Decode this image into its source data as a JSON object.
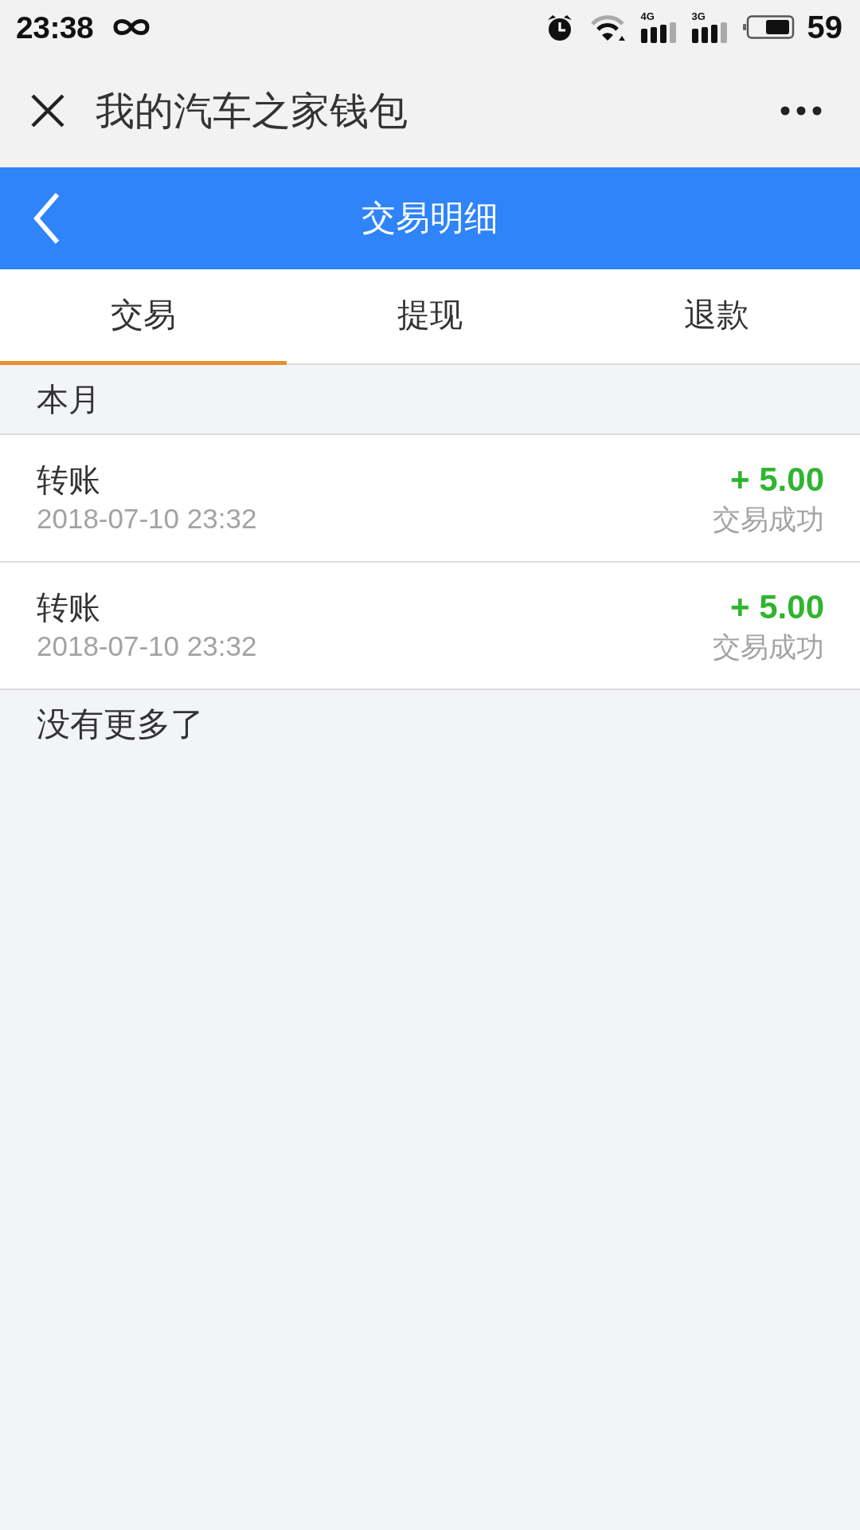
{
  "status_bar": {
    "time": "23:38",
    "networks": [
      {
        "label": "4G"
      },
      {
        "label": "3G"
      }
    ],
    "battery": "59"
  },
  "window": {
    "title": "我的汽车之家钱包"
  },
  "header": {
    "title": "交易明细"
  },
  "tabs": [
    {
      "label": "交易",
      "selected": true
    },
    {
      "label": "提现",
      "selected": false
    },
    {
      "label": "退款",
      "selected": false
    }
  ],
  "sections": [
    {
      "title": "本月",
      "rows": [
        {
          "title": "转账",
          "time": "2018-07-10 23:32",
          "amount": "+ 5.00",
          "status": "交易成功"
        },
        {
          "title": "转账",
          "time": "2018-07-10 23:32",
          "amount": "+ 5.00",
          "status": "交易成功"
        }
      ]
    }
  ],
  "footer": "没有更多了"
}
